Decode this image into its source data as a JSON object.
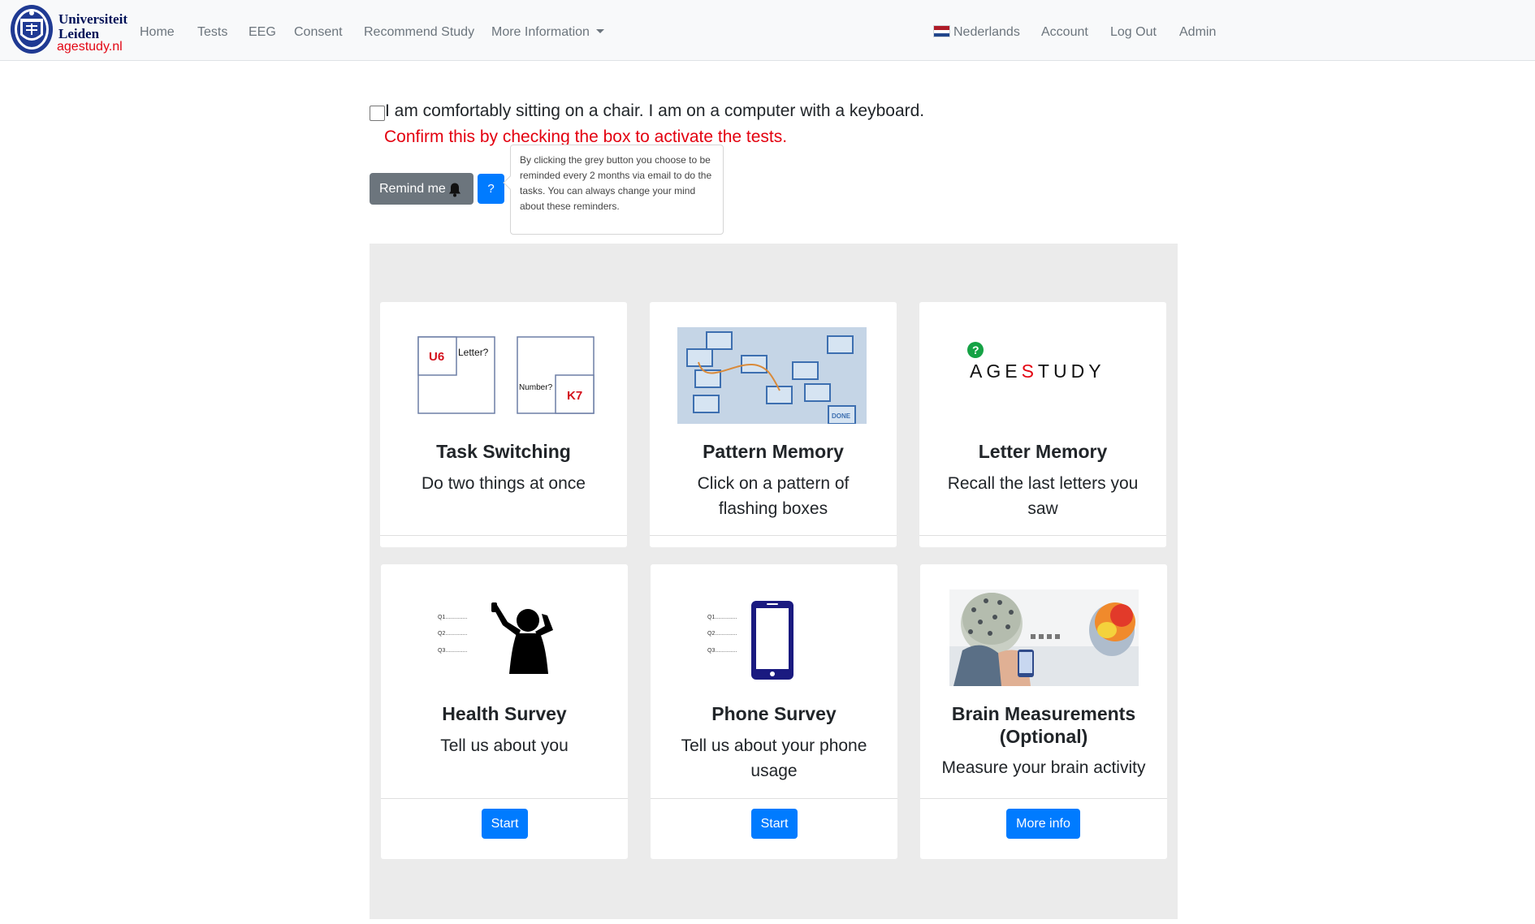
{
  "logo": {
    "line1": "Universiteit",
    "line2": "Leiden",
    "line3": "agestudy.nl"
  },
  "nav": {
    "left": [
      {
        "label": "Home"
      },
      {
        "label": "Tests"
      },
      {
        "label": "EEG"
      },
      {
        "label": "Consent"
      },
      {
        "label": "Recommend Study"
      },
      {
        "label": "More Information"
      }
    ],
    "right": [
      {
        "label": "Nederlands"
      },
      {
        "label": "Account"
      },
      {
        "label": "Log Out"
      },
      {
        "label": "Admin"
      }
    ]
  },
  "confirm": {
    "checkbox_label": "I am comfortably sitting on a chair. I am on a computer with a keyboard.",
    "checked": false,
    "warning": "Confirm this by checking the box to activate the tests."
  },
  "remind": {
    "button_label": "Remind me",
    "help_label": "?",
    "tooltip": "By clicking the grey button you choose to be reminded every 2 months via email to do the tasks. You can always change your mind about these reminders."
  },
  "cards": [
    {
      "title": "Task Switching",
      "text": "Do two things at once"
    },
    {
      "title": "Pattern Memory",
      "text": "Click on a pattern of flashing boxes"
    },
    {
      "title": "Letter Memory",
      "text": "Recall the last letters you saw"
    },
    {
      "title": "Health Survey",
      "text": "Tell us about you",
      "button": "Start"
    },
    {
      "title": "Phone Survey",
      "text": "Tell us about your phone usage",
      "button": "Start"
    },
    {
      "title": "Brain Measurements (Optional)",
      "text": "Measure your brain activity",
      "button": "More info"
    }
  ],
  "illustrations": {
    "task_switching": {
      "u6": "U6",
      "letter": "Letter?",
      "number": "Number?",
      "k7": "K7"
    },
    "pattern_memory": {
      "done": "DONE"
    },
    "agestudy": {
      "q": "?",
      "a": "AGE",
      "s": "S",
      "rest": "TUDY"
    },
    "survey_lines": [
      "Q1..............",
      "Q2..............",
      "Q3.............."
    ]
  },
  "colors": {
    "accent": "#007bff",
    "secondary": "#6c757d",
    "warning": "#e3000f",
    "navbar": "#f8f9fa",
    "grid_bg": "#ebebeb"
  }
}
